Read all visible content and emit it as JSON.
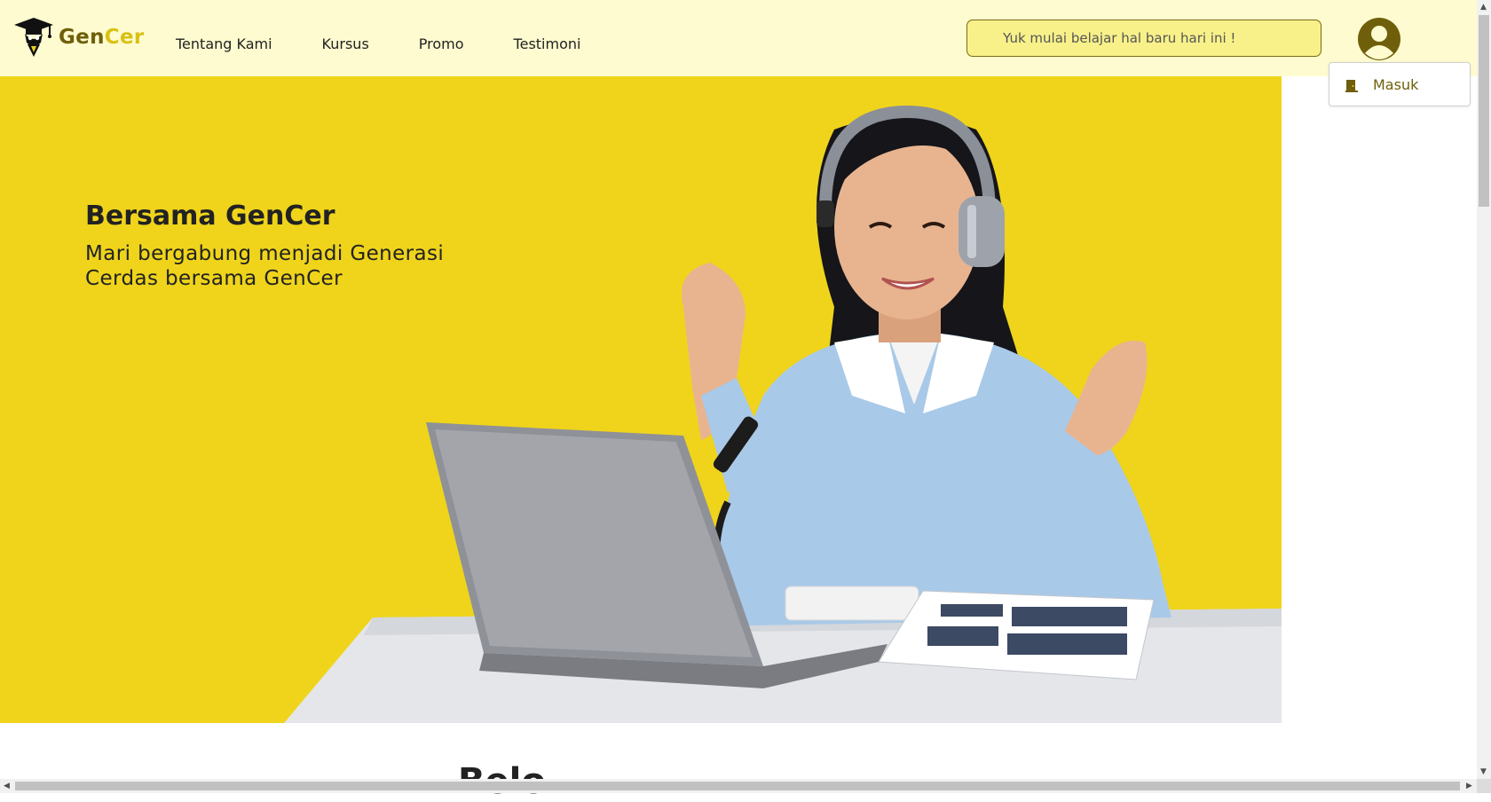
{
  "brand": {
    "name_part1": "Gen",
    "name_part2": "Cer",
    "color_dark": "#6f5f0a",
    "color_accent": "#d9c114"
  },
  "nav": {
    "items": [
      {
        "label": "Tentang Kami"
      },
      {
        "label": "Kursus"
      },
      {
        "label": "Promo"
      },
      {
        "label": "Testimoni"
      }
    ]
  },
  "search": {
    "placeholder": "Yuk mulai belajar hal baru hari ini !",
    "value": ""
  },
  "user_menu": {
    "icon": "user-circle-icon",
    "items": [
      {
        "label": "Masuk",
        "icon": "door-icon"
      }
    ]
  },
  "hero": {
    "title": "Bersama GenCer",
    "subtitle": "Mari bergabung menjadi Generasi Cerdas bersama GenCer",
    "background": "#efd41b"
  },
  "section": {
    "heading": "Belo"
  },
  "colors": {
    "navbar_bg": "#fefbd0",
    "search_bg": "#f8f18a"
  }
}
